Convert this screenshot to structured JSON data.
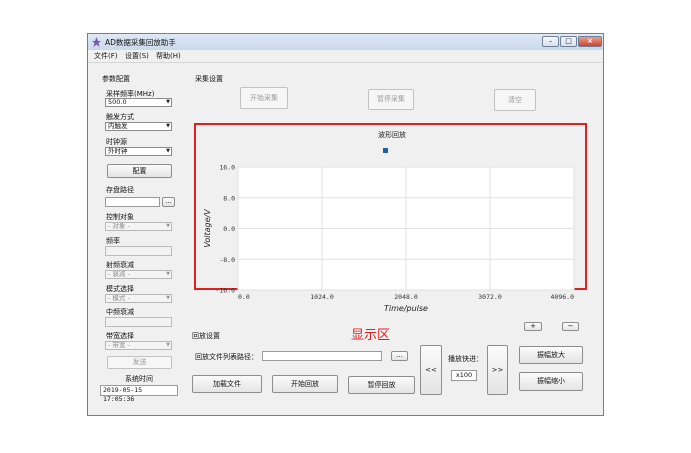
{
  "window": {
    "title": "AD数据采集回放助手"
  },
  "window_buttons": {
    "minimize": "–",
    "maximize": "□",
    "close": "×"
  },
  "menu": [
    "文件(F)",
    "设置(S)",
    "帮助(H)"
  ],
  "param_panel": {
    "heading": "参数配置",
    "sample_rate_label": "采样频率(MHz)",
    "sample_rate_value": "500.0",
    "trigger_label": "触发方式",
    "trigger_value": "内触发",
    "clock_label": "时钟源",
    "clock_value": "外时钟",
    "config_button": "配置",
    "storage_label": "存盘路径",
    "storage_value": "",
    "browse_button": "...",
    "control_label": "控制对象",
    "control_value": "- 对象 -",
    "freq_label": "频率",
    "freq_value": "",
    "rf_atten_label": "射频衰减",
    "rf_atten_value": "- 衰减 -",
    "mode_label": "模式选择",
    "mode_value": "- 模式 -",
    "if_atten_label": "中频衰减",
    "if_atten_value": "",
    "bandwidth_label": "带宽选择",
    "bandwidth_value": "- 带宽 -",
    "send_button": "发送",
    "systime_label": "系统时间",
    "systime_value": "2019-05-15 17:05:36"
  },
  "acq_panel": {
    "heading": "采集设置",
    "start_button": "开始采集",
    "pause_button": "暂停采集",
    "clear_button": "清空"
  },
  "chart_data": {
    "type": "line",
    "title": "波形回放",
    "xlabel": "Time/pulse",
    "ylabel": "Voltage/V",
    "xlim": [
      0,
      4096
    ],
    "ylim": [
      -16,
      16
    ],
    "x_ticks": [
      "0.0",
      "1024.0",
      "2048.0",
      "3072.0",
      "4096.0"
    ],
    "y_ticks": [
      "16.0",
      "8.0",
      "0.0",
      "-8.0",
      "-16.0"
    ],
    "grid": true,
    "legend": "top-center",
    "series": [
      {
        "values": []
      }
    ],
    "legend_color": "#1f5fa6"
  },
  "display_hint": "显示区",
  "playback_panel": {
    "heading": "回放设置",
    "file_list_label": "回放文件列表路径：",
    "file_list_value": "",
    "browse_button": "...",
    "load_button": "加载文件",
    "start_button": "开始回放",
    "pause_button": "暂停回放",
    "rewind_button": "<<",
    "forward_button": ">>",
    "speed_label": "播放快进：",
    "speed_value": "x100",
    "plus_button": "+",
    "minus_button": "−",
    "zoom_in_button": "振幅放大",
    "zoom_out_button": "振幅缩小"
  }
}
